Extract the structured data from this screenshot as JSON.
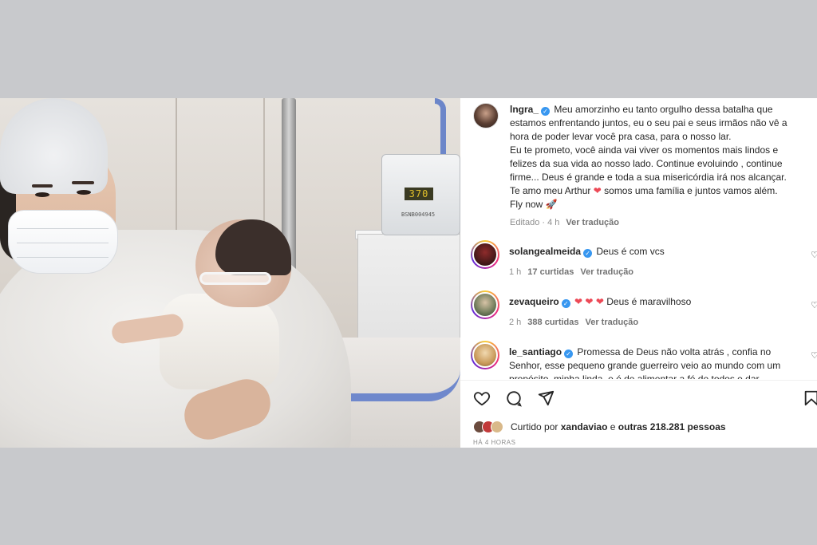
{
  "post": {
    "photo": {
      "machine_display": "370",
      "machine_label": "BSNB004945"
    },
    "caption": {
      "username": "lngra_",
      "verified_glyph": "✓",
      "text_p1": "Meu amorzinho eu tanto orgulho dessa batalha que estamos enfrentando juntos, eu o seu pai e seus irmãos não vê a hora de poder levar você pra casa, para o nosso lar.",
      "text_p2": "Eu te prometo, você ainda vai viver os momentos mais lindos e felizes da sua vida ao nosso lado. Continue evoluindo , continue firme... Deus é grande e toda a sua misericórdia irá nos alcançar.",
      "text_p3_a": "Te amo meu Arthur",
      "heart": "❤",
      "text_p3_b": "somos uma família e juntos vamos além.",
      "text_p4": "Fly now",
      "rocket": "🚀",
      "edited": "Editado · 4 h",
      "translate": "Ver tradução"
    },
    "comments": [
      {
        "username": "solangealmeida",
        "text": "Deus é com vcs",
        "time": "1 h",
        "likes": "17 curtidas",
        "translate": "Ver tradução"
      },
      {
        "username": "zevaqueiro",
        "hearts": "❤ ❤ ❤",
        "text": "Deus é maravilhoso",
        "time": "2 h",
        "likes": "388 curtidas",
        "translate": "Ver tradução"
      },
      {
        "username": "le_santiago",
        "text": "Promessa de Deus não volta atrás , confia no Senhor, esse pequeno grande guerreiro veio ao mundo com um propósito, minha linda, e é de alimentar a fé de todos e dar"
      }
    ],
    "likes": {
      "prefix": "Curtido por",
      "user": "xandaviao",
      "connector": "e",
      "others": "outras 218.281 pessoas"
    },
    "timestamp": "HÁ 4 HORAS",
    "icons": {
      "like": "heart-outline-icon",
      "comment": "comment-icon",
      "share": "send-icon",
      "save": "bookmark-icon"
    },
    "colors": {
      "verified": "#3897f0",
      "heart": "#ed4956",
      "muted": "#8e8e8e",
      "page_bg": "#c8c9cc"
    }
  }
}
